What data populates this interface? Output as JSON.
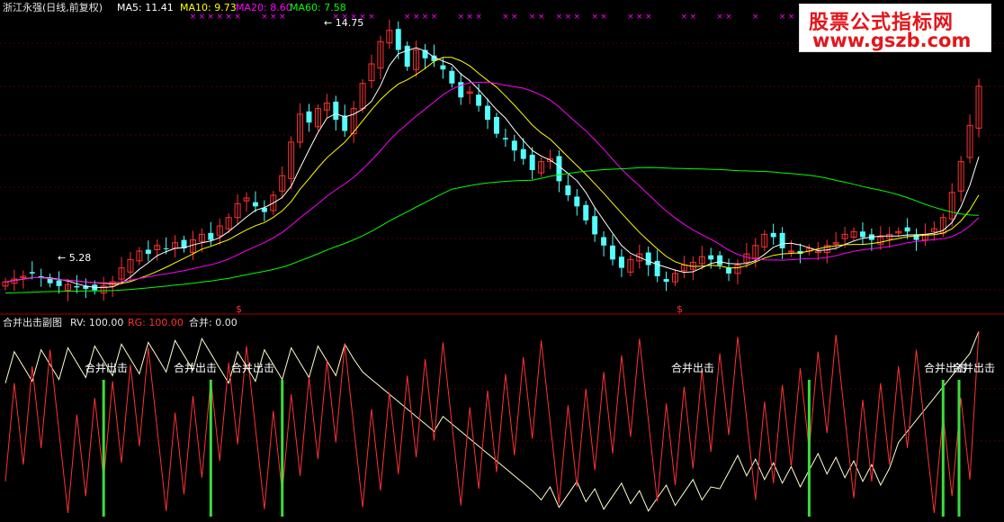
{
  "header": {
    "title": "浙江永强(日线,前复权)",
    "ma5": "MA5: 11.41",
    "ma10": "MA10: 9.73",
    "ma20": "MA20: 8.60",
    "ma60": "MA60: 7.58"
  },
  "price_panel": {
    "high_marker": "14.75",
    "low_marker": "5.28",
    "dividend_marker": "$"
  },
  "sub_panel": {
    "name": "合并出击副图",
    "rv": "RV: 100.00",
    "rg": "RG: 100.00",
    "combined": "合并: 0.00",
    "signal_label": "合并出击"
  },
  "watermark": {
    "line1": "股票公式指标网",
    "line2": "www.gszb.com"
  },
  "colors": {
    "up": "#ff3232",
    "down": "#54ffff",
    "ma5": "#ffffff",
    "ma10": "#ffff00",
    "ma20": "#ff00ff",
    "ma60": "#00ff00",
    "rv": "#ffffcc",
    "rg": "#ff3232",
    "signal": "#3cdc3c"
  },
  "chart_data": {
    "type": "candlestick-with-oscillator",
    "bars": 110,
    "price_range": [
      4.8,
      15.3
    ],
    "closes": [
      5.6,
      5.7,
      5.8,
      5.9,
      5.75,
      5.55,
      5.45,
      5.5,
      5.4,
      5.35,
      5.3,
      5.45,
      5.6,
      6.1,
      6.4,
      6.7,
      6.6,
      6.9,
      6.8,
      7.0,
      6.8,
      7.1,
      7.3,
      7.1,
      7.6,
      7.9,
      8.4,
      8.6,
      8.3,
      8.1,
      8.7,
      9.4,
      10.6,
      11.6,
      11.3,
      11.8,
      12.0,
      11.4,
      11.0,
      11.8,
      12.7,
      13.4,
      14.2,
      14.6,
      13.9,
      13.3,
      13.9,
      13.6,
      13.5,
      13.2,
      12.7,
      12.2,
      12.4,
      11.9,
      11.4,
      10.9,
      10.7,
      10.3,
      10.0,
      9.6,
      9.9,
      10.0,
      9.2,
      8.7,
      8.3,
      7.8,
      7.3,
      6.9,
      6.4,
      6.1,
      6.4,
      6.6,
      6.2,
      5.8,
      5.6,
      5.9,
      6.2,
      6.3,
      6.5,
      6.4,
      6.2,
      5.9,
      6.2,
      6.6,
      6.9,
      7.3,
      7.2,
      6.8,
      6.7,
      6.6,
      6.8,
      6.7,
      6.9,
      7.0,
      7.3,
      7.4,
      7.2,
      7.1,
      7.2,
      7.3,
      7.4,
      7.4,
      7.1,
      7.3,
      7.5,
      7.9,
      8.8,
      9.9,
      11.2,
      12.6
    ],
    "ma5_label": 11.41,
    "ma10_label": 9.73,
    "ma20_label": 8.6,
    "ma60_label": 7.58,
    "sub_range": [
      0,
      100
    ],
    "rv_end": 100.0,
    "rg_end": 100.0,
    "combined": 0.0,
    "signal_bars": [
      11,
      23,
      31,
      90,
      105,
      108,
      110
    ]
  }
}
